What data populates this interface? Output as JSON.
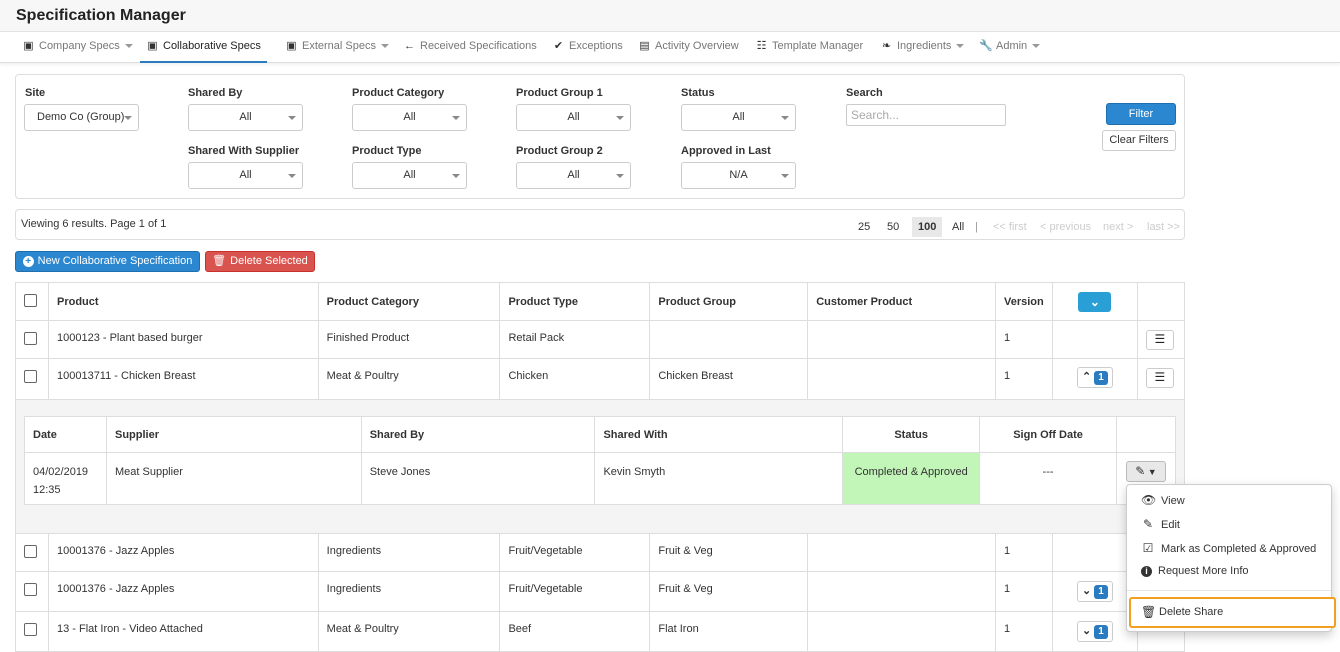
{
  "app": {
    "title": "Specification Manager"
  },
  "nav": {
    "company_specs": "Company Specs",
    "collaborative_specs": "Collaborative Specs",
    "external_specs": "External Specs",
    "received_specs": "Received Specifications",
    "exceptions": "Exceptions",
    "activity_overview": "Activity Overview",
    "template_manager": "Template Manager",
    "ingredients": "Ingredients",
    "admin": "Admin"
  },
  "filters": {
    "site": {
      "label": "Site",
      "value": "Demo Co (Group)"
    },
    "shared_by": {
      "label": "Shared By",
      "value": "All"
    },
    "product_category": {
      "label": "Product Category",
      "value": "All"
    },
    "product_group_1": {
      "label": "Product Group 1",
      "value": "All"
    },
    "status": {
      "label": "Status",
      "value": "All"
    },
    "search": {
      "label": "Search",
      "placeholder": "Search..."
    },
    "shared_with_supplier": {
      "label": "Shared With Supplier",
      "value": "All"
    },
    "product_type": {
      "label": "Product Type",
      "value": "All"
    },
    "product_group_2": {
      "label": "Product Group 2",
      "value": "All"
    },
    "approved_in_last": {
      "label": "Approved in Last",
      "value": "N/A"
    },
    "filter_button": "Filter",
    "clear_button": "Clear Filters"
  },
  "pagination": {
    "summary": "Viewing 6 results. Page 1 of 1",
    "sizes": [
      "25",
      "50",
      "100",
      "All"
    ],
    "current_size": "100",
    "separator": "|",
    "first": "<< first",
    "previous": "< previous",
    "next": "next >",
    "last": "last >>"
  },
  "actions": {
    "new_spec": "New Collaborative Specification",
    "delete_selected": "Delete Selected"
  },
  "table": {
    "columns": [
      "Product",
      "Product Category",
      "Product Type",
      "Product Group",
      "Customer Product",
      "Version"
    ],
    "rows": [
      {
        "product": "1000123 - Plant based burger",
        "category": "Finished Product",
        "type": "Retail Pack",
        "group": "",
        "customer": "",
        "version": "1",
        "shares": ""
      },
      {
        "product": "100013711 - Chicken Breast",
        "category": "Meat & Poultry",
        "type": "Chicken",
        "group": "Chicken Breast",
        "customer": "",
        "version": "1",
        "shares": "1"
      },
      {
        "product": "10001376 - Jazz Apples",
        "category": "Ingredients",
        "type": "Fruit/Vegetable",
        "group": "Fruit & Veg",
        "customer": "",
        "version": "1",
        "shares": ""
      },
      {
        "product": "10001376 - Jazz Apples",
        "category": "Ingredients",
        "type": "Fruit/Vegetable",
        "group": "Fruit & Veg",
        "customer": "",
        "version": "1",
        "shares": "1"
      },
      {
        "product": "13 - Flat Iron - Video Attached",
        "category": "Meat & Poultry",
        "type": "Beef",
        "group": "Flat Iron",
        "customer": "",
        "version": "1",
        "shares": "1"
      }
    ]
  },
  "shares": {
    "columns": [
      "Date",
      "Supplier",
      "Shared By",
      "Shared With",
      "Status",
      "Sign Off Date"
    ],
    "rows": [
      {
        "date": "04/02/2019",
        "time": "12:35",
        "supplier": "Meat Supplier",
        "shared_by": "Steve Jones",
        "shared_with": "Kevin Smyth",
        "status": "Completed & Approved",
        "sign_off": "---"
      }
    ],
    "status_color": "#c2f5b8"
  },
  "menu": {
    "view": "View",
    "edit": "Edit",
    "mark_completed": "Mark as Completed & Approved",
    "request_info": "Request More Info",
    "delete_share": "Delete Share"
  },
  "colors": {
    "accent": "#2a87d0",
    "danger": "#d9534f",
    "highlight": "#f0a020"
  }
}
